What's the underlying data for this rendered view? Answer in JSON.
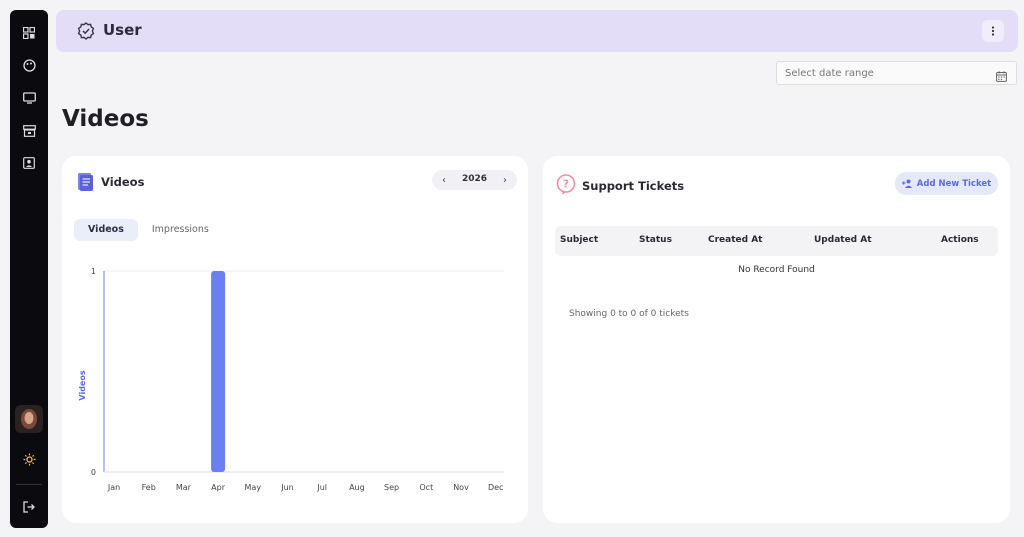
{
  "topbar": {
    "title": "User"
  },
  "date_range": {
    "placeholder": "Select date range"
  },
  "page": {
    "title": "Videos"
  },
  "videos_card": {
    "title": "Videos",
    "year": "2026",
    "tabs": [
      "Videos",
      "Impressions"
    ],
    "active_tab": "Videos"
  },
  "chart_data": {
    "type": "bar",
    "categories": [
      "Jan",
      "Feb",
      "Mar",
      "Apr",
      "May",
      "Jun",
      "Jul",
      "Aug",
      "Sep",
      "Oct",
      "Nov",
      "Dec"
    ],
    "values": [
      0,
      0,
      0,
      1,
      0,
      0,
      0,
      0,
      0,
      0,
      0,
      0
    ],
    "ylabel": "Videos",
    "yticks": [
      "0",
      "1"
    ],
    "ylim": [
      0,
      1
    ],
    "grid": true,
    "bar_color": "#6b7ff0"
  },
  "support_card": {
    "title": "Support Tickets",
    "add_button": "Add New Ticket",
    "columns": [
      "Subject",
      "Status",
      "Created At",
      "Updated At",
      "Actions"
    ],
    "empty_text": "No Record Found",
    "showing_text": "Showing 0 to 0 of 0 tickets"
  },
  "colors": {
    "accent": "#6b7ff0",
    "topbar_bg": "#e3ddf7",
    "sidebar_bg": "#0b0b0f"
  }
}
